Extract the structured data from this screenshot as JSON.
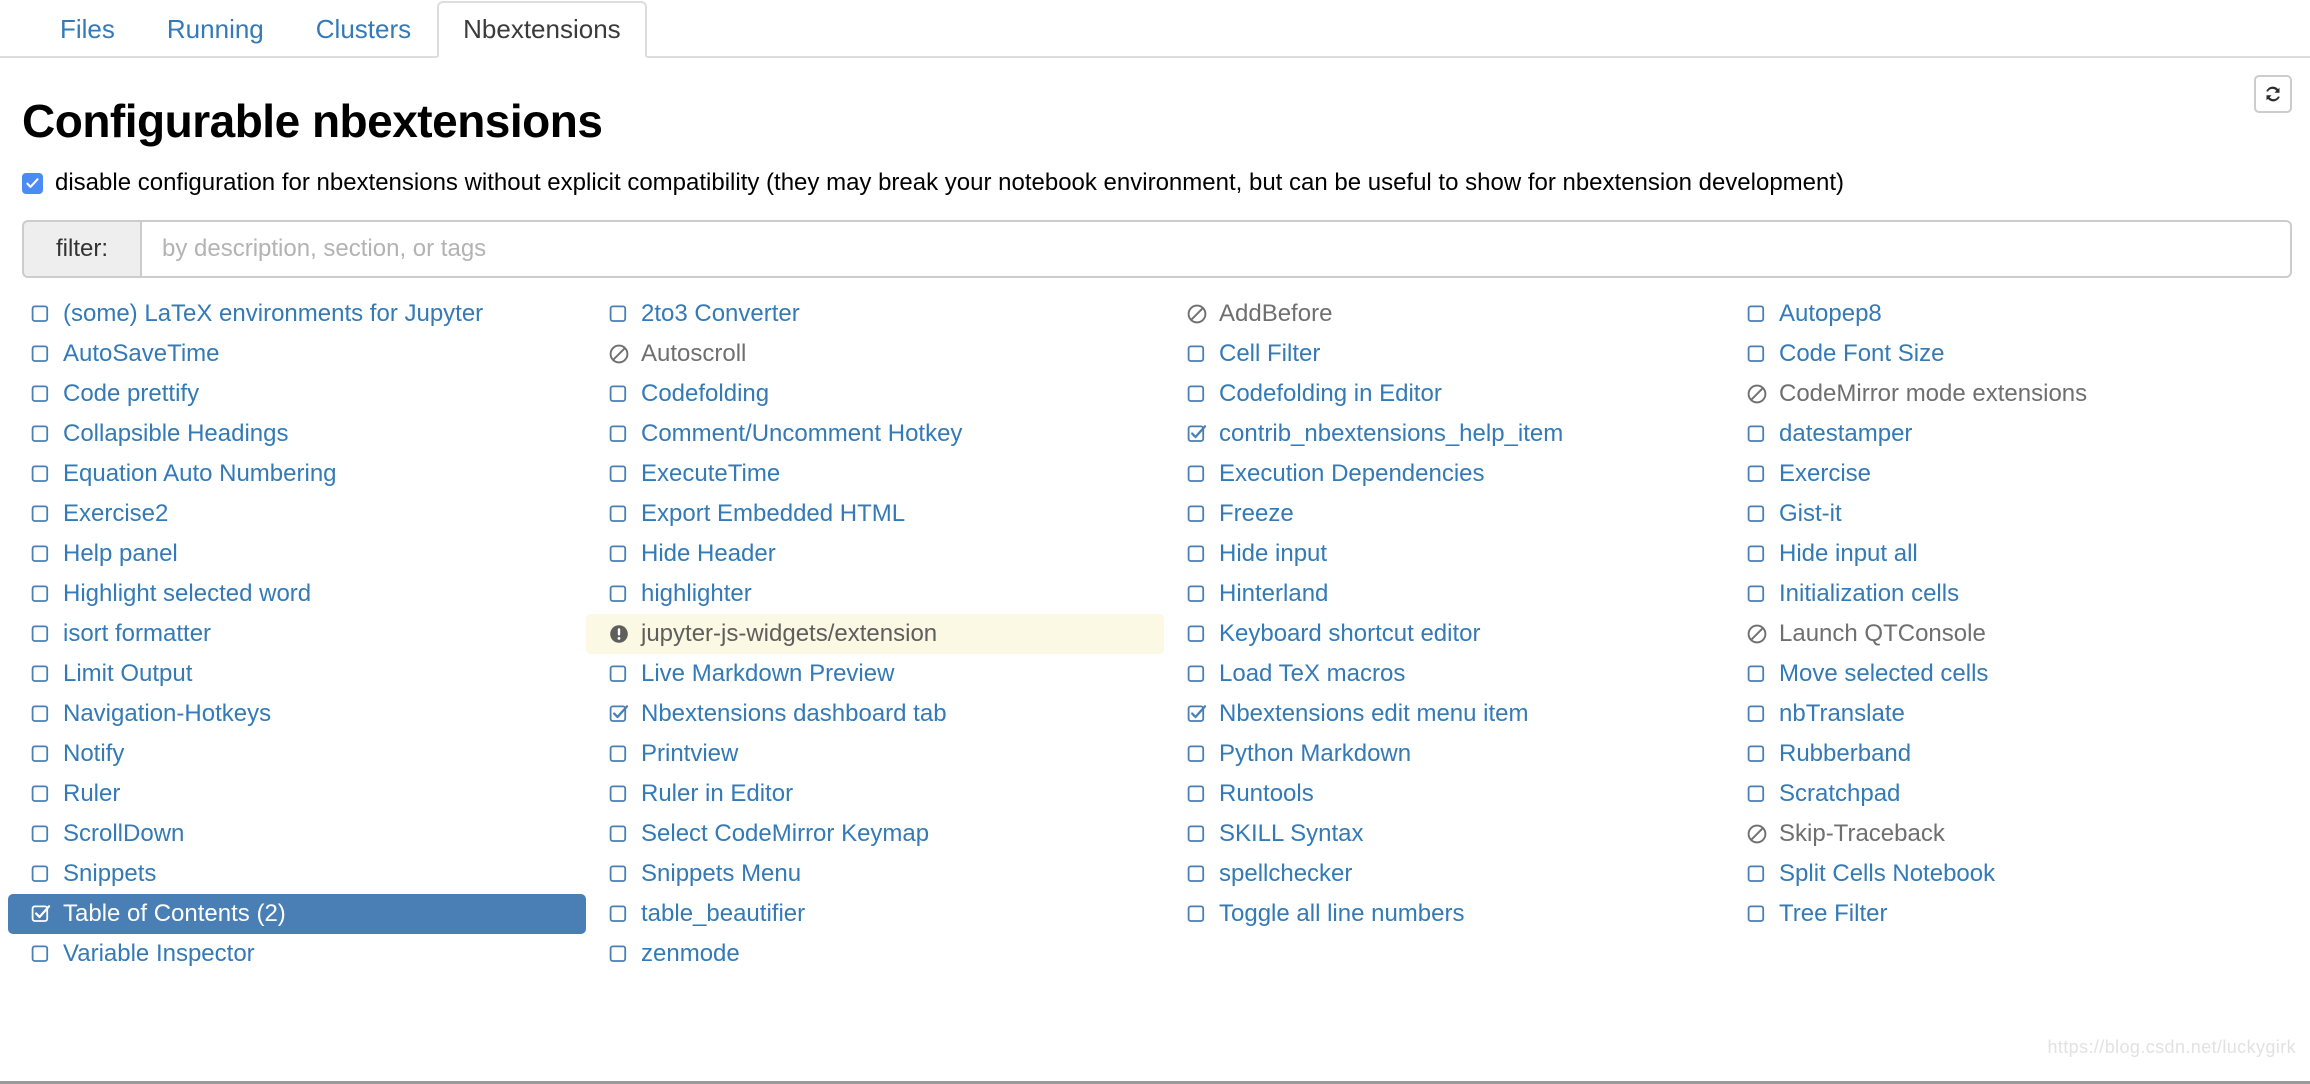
{
  "colors": {
    "link": "#337ab7",
    "selected_bg": "#4a7fb5",
    "warn_bg": "#fbf8e3",
    "disabled_text": "#6f6f6f",
    "checkbox_accent": "#4c8bf5"
  },
  "tabs": [
    {
      "label": "Files",
      "active": false
    },
    {
      "label": "Running",
      "active": false
    },
    {
      "label": "Clusters",
      "active": false
    },
    {
      "label": "Nbextensions",
      "active": true
    }
  ],
  "toolbar": {
    "refresh_icon": "refresh-icon"
  },
  "header": {
    "title": "Configurable nbextensions"
  },
  "compat": {
    "checked": true,
    "label": "disable configuration for nbextensions without explicit compatibility (they may break your notebook environment, but can be useful to show for nbextension development)"
  },
  "filter": {
    "addon_label": "filter:",
    "placeholder": "by description, section, or tags",
    "value": ""
  },
  "watermark": "https://blog.csdn.net/luckygirk",
  "columns": [
    [
      {
        "label": "(some) LaTeX environments for Jupyter",
        "state": "unchecked"
      },
      {
        "label": "AutoSaveTime",
        "state": "unchecked"
      },
      {
        "label": "Code prettify",
        "state": "unchecked"
      },
      {
        "label": "Collapsible Headings",
        "state": "unchecked"
      },
      {
        "label": "Equation Auto Numbering",
        "state": "unchecked"
      },
      {
        "label": "Exercise2",
        "state": "unchecked"
      },
      {
        "label": "Help panel",
        "state": "unchecked"
      },
      {
        "label": "Highlight selected word",
        "state": "unchecked"
      },
      {
        "label": "isort formatter",
        "state": "unchecked"
      },
      {
        "label": "Limit Output",
        "state": "unchecked"
      },
      {
        "label": "Navigation-Hotkeys",
        "state": "unchecked"
      },
      {
        "label": "Notify",
        "state": "unchecked"
      },
      {
        "label": "Ruler",
        "state": "unchecked"
      },
      {
        "label": "ScrollDown",
        "state": "unchecked"
      },
      {
        "label": "Snippets",
        "state": "unchecked"
      },
      {
        "label": "Table of Contents (2)",
        "state": "checked",
        "selected": true
      },
      {
        "label": "Variable Inspector",
        "state": "unchecked"
      }
    ],
    [
      {
        "label": "2to3 Converter",
        "state": "unchecked"
      },
      {
        "label": "Autoscroll",
        "state": "incompatible"
      },
      {
        "label": "Codefolding",
        "state": "unchecked"
      },
      {
        "label": "Comment/Uncomment Hotkey",
        "state": "unchecked"
      },
      {
        "label": "ExecuteTime",
        "state": "unchecked"
      },
      {
        "label": "Export Embedded HTML",
        "state": "unchecked"
      },
      {
        "label": "Hide Header",
        "state": "unchecked"
      },
      {
        "label": "highlighter",
        "state": "unchecked"
      },
      {
        "label": "jupyter-js-widgets/extension",
        "state": "warning",
        "highlight": true
      },
      {
        "label": "Live Markdown Preview",
        "state": "unchecked"
      },
      {
        "label": "Nbextensions dashboard tab",
        "state": "checked"
      },
      {
        "label": "Printview",
        "state": "unchecked"
      },
      {
        "label": "Ruler in Editor",
        "state": "unchecked"
      },
      {
        "label": "Select CodeMirror Keymap",
        "state": "unchecked"
      },
      {
        "label": "Snippets Menu",
        "state": "unchecked"
      },
      {
        "label": "table_beautifier",
        "state": "unchecked"
      },
      {
        "label": "zenmode",
        "state": "unchecked"
      }
    ],
    [
      {
        "label": "AddBefore",
        "state": "incompatible"
      },
      {
        "label": "Cell Filter",
        "state": "unchecked"
      },
      {
        "label": "Codefolding in Editor",
        "state": "unchecked"
      },
      {
        "label": "contrib_nbextensions_help_item",
        "state": "checked"
      },
      {
        "label": "Execution Dependencies",
        "state": "unchecked"
      },
      {
        "label": "Freeze",
        "state": "unchecked"
      },
      {
        "label": "Hide input",
        "state": "unchecked"
      },
      {
        "label": "Hinterland",
        "state": "unchecked"
      },
      {
        "label": "Keyboard shortcut editor",
        "state": "unchecked"
      },
      {
        "label": "Load TeX macros",
        "state": "unchecked"
      },
      {
        "label": "Nbextensions edit menu item",
        "state": "checked"
      },
      {
        "label": "Python Markdown",
        "state": "unchecked"
      },
      {
        "label": "Runtools",
        "state": "unchecked"
      },
      {
        "label": "SKILL Syntax",
        "state": "unchecked"
      },
      {
        "label": "spellchecker",
        "state": "unchecked"
      },
      {
        "label": "Toggle all line numbers",
        "state": "unchecked"
      }
    ],
    [
      {
        "label": "Autopep8",
        "state": "unchecked"
      },
      {
        "label": "Code Font Size",
        "state": "unchecked"
      },
      {
        "label": "CodeMirror mode extensions",
        "state": "incompatible"
      },
      {
        "label": "datestamper",
        "state": "unchecked"
      },
      {
        "label": "Exercise",
        "state": "unchecked"
      },
      {
        "label": "Gist-it",
        "state": "unchecked"
      },
      {
        "label": "Hide input all",
        "state": "unchecked"
      },
      {
        "label": "Initialization cells",
        "state": "unchecked"
      },
      {
        "label": "Launch QTConsole",
        "state": "incompatible"
      },
      {
        "label": "Move selected cells",
        "state": "unchecked"
      },
      {
        "label": "nbTranslate",
        "state": "unchecked"
      },
      {
        "label": "Rubberband",
        "state": "unchecked"
      },
      {
        "label": "Scratchpad",
        "state": "unchecked"
      },
      {
        "label": "Skip-Traceback",
        "state": "incompatible"
      },
      {
        "label": "Split Cells Notebook",
        "state": "unchecked"
      },
      {
        "label": "Tree Filter",
        "state": "unchecked"
      }
    ]
  ]
}
